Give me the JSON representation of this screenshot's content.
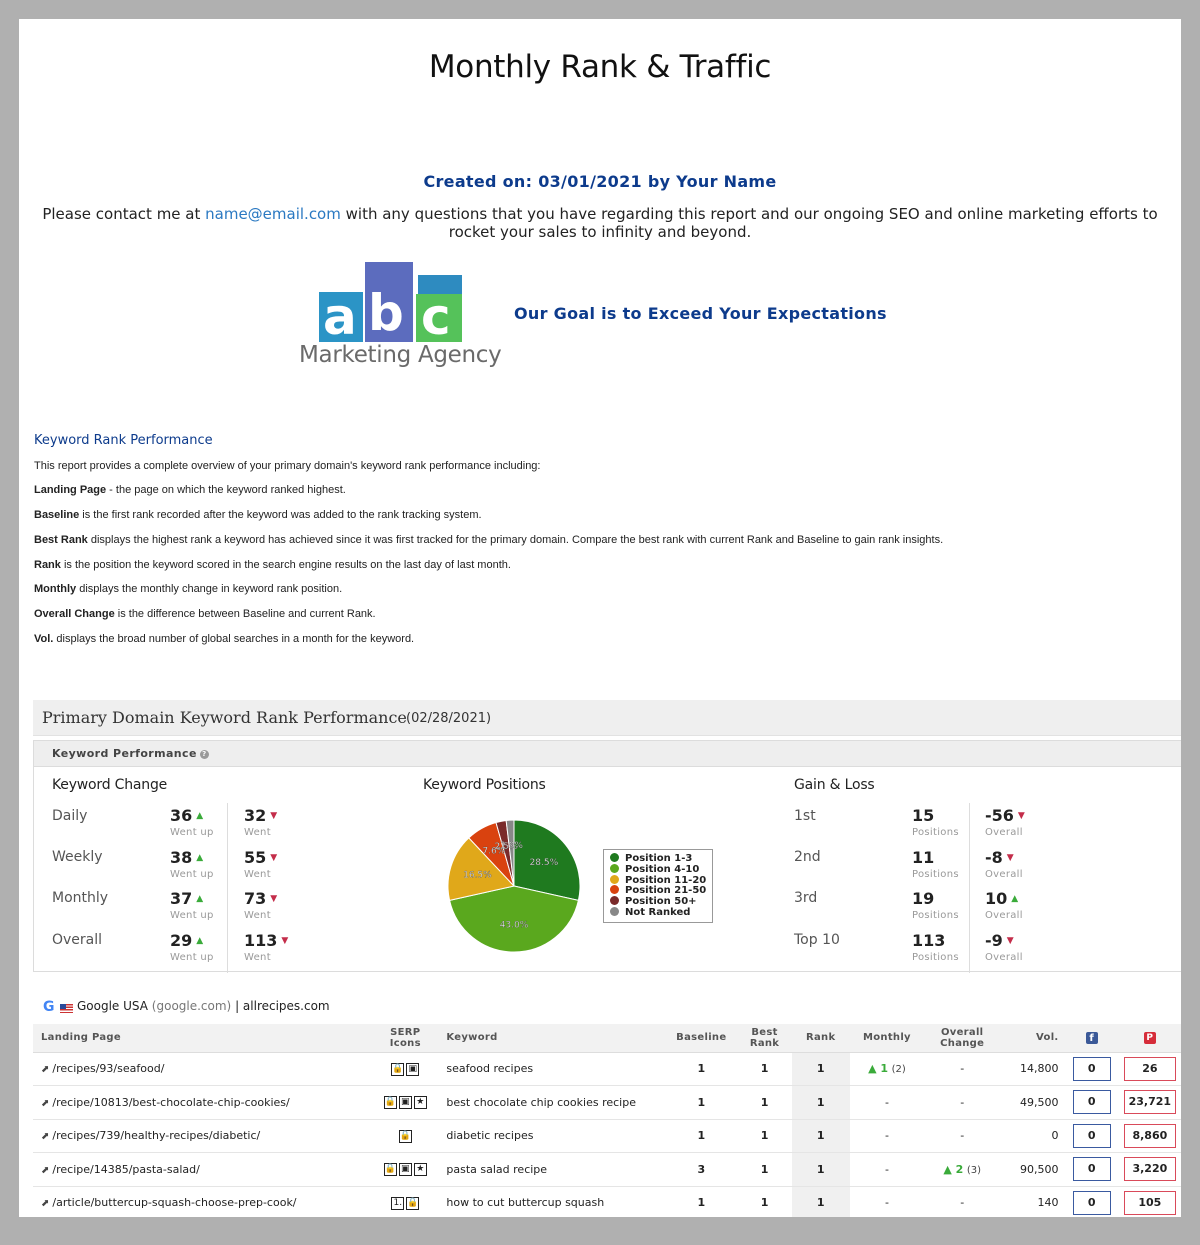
{
  "report": {
    "title": "Monthly Rank & Traffic",
    "created": "Created on: 03/01/2021 by Your Name",
    "contact_pre": "Please contact me at ",
    "contact_email": "name@email.com",
    "contact_post": " with any questions that you have regarding this report and our ongoing SEO and online marketing efforts to rocket your sales to infinity and beyond.",
    "logo_letters": [
      "a",
      "b",
      "c"
    ],
    "logo_agency": "Marketing Agency",
    "logo_colors": {
      "purple": "#5c6cbe",
      "blue": "#2e8bc0",
      "green": "#55c25a"
    },
    "goal": "Our Goal is to Exceed Your Expectations"
  },
  "krp": {
    "heading": "Keyword Rank Performance",
    "intro": "This report provides a complete overview of your primary domain's keyword rank performance including:",
    "defs": [
      {
        "term": "Landing Page",
        "text": " - the page on which the keyword ranked highest."
      },
      {
        "term": "Baseline",
        "text": " is the first rank recorded after the keyword was added to the rank tracking system."
      },
      {
        "term": "Best Rank",
        "text": " displays the highest rank a keyword has achieved since it was first tracked for the primary domain. Compare the best rank with current Rank and Baseline to gain rank insights."
      },
      {
        "term": "Rank",
        "text": " is the position the keyword scored in the search engine results on the last day of last month."
      },
      {
        "term": "Monthly",
        "text": " displays the monthly change in keyword rank position."
      },
      {
        "term": "Overall Change",
        "text": " is the difference between Baseline and current Rank."
      },
      {
        "term": "Vol.",
        "text": " displays the broad number of global searches in a month for the keyword."
      }
    ]
  },
  "panel": {
    "title": "Primary Domain Keyword Rank Performance",
    "date": "(02/28/2021)",
    "kp_head": "Keyword Performance",
    "keyword_change": {
      "title": "Keyword Change",
      "rows": [
        {
          "label": "Daily",
          "up": "36",
          "down": "32"
        },
        {
          "label": "Weekly",
          "up": "38",
          "down": "55"
        },
        {
          "label": "Monthly",
          "up": "37",
          "down": "73"
        },
        {
          "label": "Overall",
          "up": "29",
          "down": "113"
        }
      ],
      "up_sub": "Went up",
      "down_sub": "Went"
    },
    "positions_title": "Keyword Positions",
    "gain_loss": {
      "title": "Gain & Loss",
      "rows": [
        {
          "label": "1st",
          "pos": "15",
          "overall": "-56",
          "dir": "down"
        },
        {
          "label": "2nd",
          "pos": "11",
          "overall": "-8",
          "dir": "down"
        },
        {
          "label": "3rd",
          "pos": "19",
          "overall": "10",
          "dir": "up"
        },
        {
          "label": "Top 10",
          "pos": "113",
          "overall": "-9",
          "dir": "down"
        }
      ],
      "pos_sub": "Positions",
      "overall_sub": "Overall"
    }
  },
  "chart_data": {
    "type": "pie",
    "title": "Keyword Positions",
    "categories": [
      "Position 1-3",
      "Position 4-10",
      "Position 11-20",
      "Position 21-50",
      "Position 50+",
      "Not Ranked"
    ],
    "values": [
      28.5,
      43.0,
      16.5,
      7.6,
      2.5,
      1.9
    ],
    "labels": [
      "28.5%",
      "43.0%",
      "16.5%",
      "7.6%",
      "2.5%",
      "1.9%"
    ],
    "colors": [
      "#1f7a1f",
      "#5aa81e",
      "#e0a81a",
      "#d9420f",
      "#7a2a2a",
      "#888888"
    ],
    "legend_position": "right"
  },
  "table": {
    "engine": "Google USA",
    "engine_domain": "(google.com)",
    "site": " | allrecipes.com",
    "headers": {
      "landing": "Landing Page",
      "serp1": "SERP",
      "serp2": "Icons",
      "keyword": "Keyword",
      "baseline": "Baseline",
      "best1": "Best",
      "best2": "Rank",
      "rank": "Rank",
      "monthly": "Monthly",
      "over1": "Overall",
      "over2": "Change",
      "vol": "Vol."
    },
    "rows": [
      {
        "landing": "/recipes/93/seafood/",
        "serp": [
          "🔒",
          "▣"
        ],
        "keyword": "seafood recipes",
        "baseline": "1",
        "best": "1",
        "rank": "1",
        "monthly": "▲ 1",
        "monthly_ctx": "(2)",
        "overall": "-",
        "overall_ctx": "",
        "vol": "14,800",
        "fb": "0",
        "pin": "26"
      },
      {
        "landing": "/recipe/10813/best-chocolate-chip-cookies/",
        "serp": [
          "🔒",
          "▣",
          "★"
        ],
        "keyword": "best chocolate chip cookies recipe",
        "baseline": "1",
        "best": "1",
        "rank": "1",
        "monthly": "-",
        "monthly_ctx": "",
        "overall": "-",
        "overall_ctx": "",
        "vol": "49,500",
        "fb": "0",
        "pin": "23,721"
      },
      {
        "landing": "/recipes/739/healthy-recipes/diabetic/",
        "serp": [
          "🔒"
        ],
        "keyword": "diabetic recipes",
        "baseline": "1",
        "best": "1",
        "rank": "1",
        "monthly": "-",
        "monthly_ctx": "",
        "overall": "-",
        "overall_ctx": "",
        "vol": "0",
        "fb": "0",
        "pin": "8,860"
      },
      {
        "landing": "/recipe/14385/pasta-salad/",
        "serp": [
          "🔒",
          "▣",
          "★"
        ],
        "keyword": "pasta salad recipe",
        "baseline": "3",
        "best": "1",
        "rank": "1",
        "monthly": "-",
        "monthly_ctx": "",
        "overall": "▲ 2",
        "overall_ctx": "(3)",
        "vol": "90,500",
        "fb": "0",
        "pin": "3,220"
      },
      {
        "landing": "/article/buttercup-squash-choose-prep-cook/",
        "serp": [
          "1.",
          "🔒"
        ],
        "keyword": "how to cut buttercup squash",
        "baseline": "1",
        "best": "1",
        "rank": "1",
        "monthly": "-",
        "monthly_ctx": "",
        "overall": "-",
        "overall_ctx": "",
        "vol": "140",
        "fb": "0",
        "pin": "105"
      }
    ]
  }
}
